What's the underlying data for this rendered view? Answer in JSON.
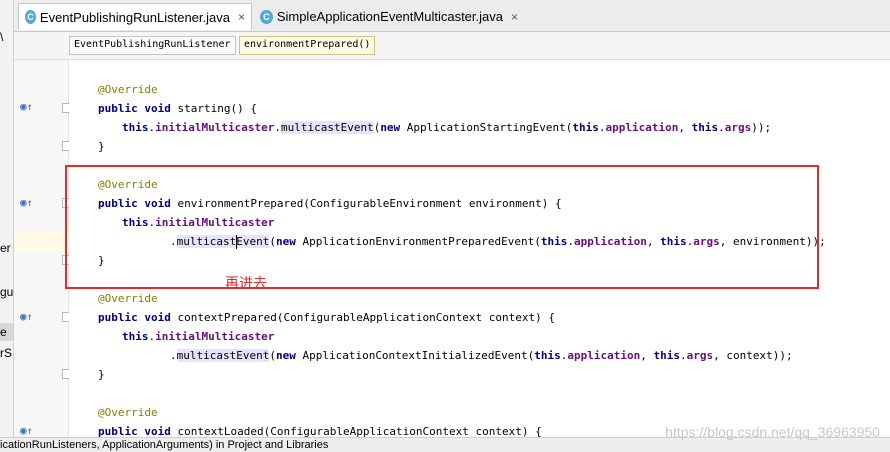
{
  "tabs": [
    {
      "label": "EventPublishingRunListener.java",
      "active": true
    },
    {
      "label": "SimpleApplicationEventMulticaster.java",
      "active": false
    }
  ],
  "tab_close_glyph": "×",
  "tab_class_icon_letter": "C",
  "breadcrumbs": [
    "EventPublishingRunListener",
    "environmentPrepared()"
  ],
  "left_panel_fragments": [
    "\\ ",
    "er",
    "gur",
    "e",
    "rS"
  ],
  "code": {
    "l1": "@Override",
    "l2a": "public void",
    "l2b": " starting() {",
    "l3a": "this",
    "l3b": ".",
    "l3c": "initialMulticaster",
    "l3d": ".",
    "l3e": "multicastEvent",
    "l3f": "(",
    "l3g": "new",
    "l3h": " ApplicationStartingEvent(",
    "l3i": "this",
    "l3j": ".",
    "l3k": "application",
    "l3l": ", ",
    "l3m": "this",
    "l3n": ".",
    "l3o": "args",
    "l3p": "));",
    "l4": "}",
    "l5": "@Override",
    "l6a": "public void",
    "l6b": " environmentPrepared(ConfigurableEnvironment environment) {",
    "l7a": "this",
    "l7b": ".",
    "l7c": "initialMulticaster",
    "l8a": ".",
    "l8b1": "multicast",
    "l8b2": "Event",
    "l8c": "(",
    "l8d": "new",
    "l8e": " ApplicationEnvironmentPreparedEvent(",
    "l8f": "this",
    "l8g": ".",
    "l8h": "application",
    "l8i": ", ",
    "l8j": "this",
    "l8k": ".",
    "l8l": "args",
    "l8m": ", environment));",
    "l9": "}",
    "l10": "@Override",
    "l11a": "public void",
    "l11b": " contextPrepared(ConfigurableApplicationContext context) {",
    "l12a": "this",
    "l12b": ".",
    "l12c": "initialMulticaster",
    "l13a": ".",
    "l13b": "multicastEvent",
    "l13c": "(",
    "l13d": "new",
    "l13e": " ApplicationContextInitializedEvent(",
    "l13f": "this",
    "l13g": ".",
    "l13h": "application",
    "l13i": ", ",
    "l13j": "this",
    "l13k": ".",
    "l13l": "args",
    "l13m": ", context));",
    "l14": "}",
    "l15": "@Override",
    "l16a": "public void",
    "l16b": " contextLoaded(ConfigurableApplicationContext context) {"
  },
  "annotation_note": "再进去",
  "status_text": "icationRunListeners, ApplicationArguments) in Project and Libraries",
  "watermark": "https://blog.csdn.net/qq_36963950",
  "colors": {
    "highlight": "#e02b2b",
    "keyword": "#000080",
    "field": "#660e7a",
    "annotation": "#808000"
  }
}
